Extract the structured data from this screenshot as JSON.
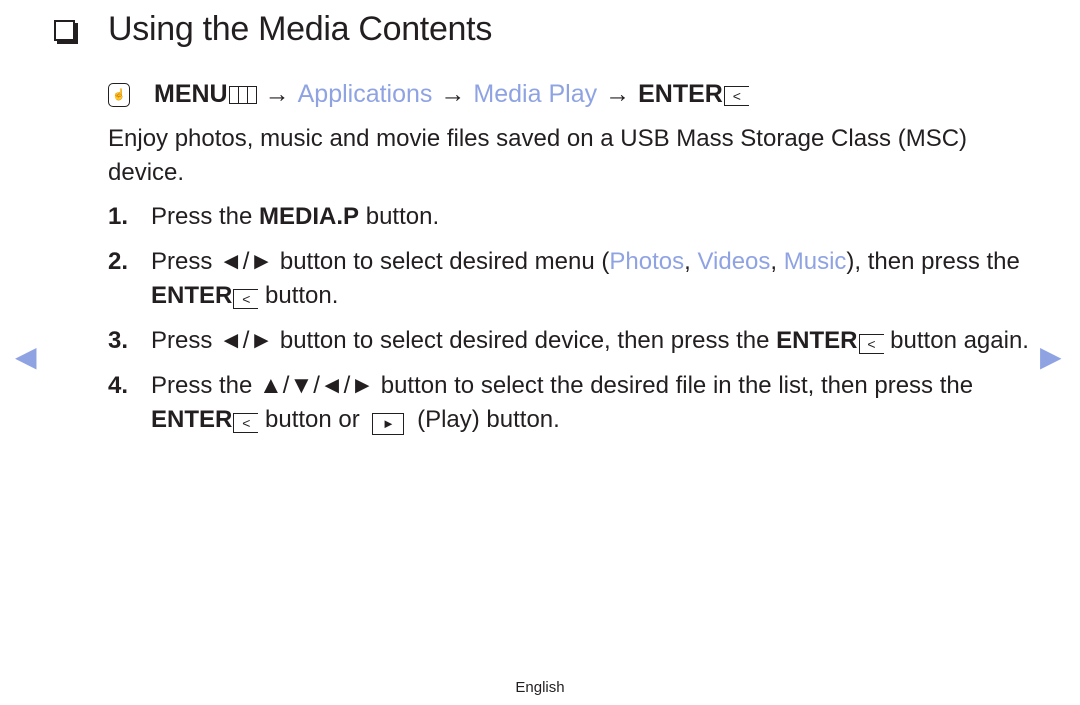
{
  "title": "Using the Media Contents",
  "menu_path": {
    "icon": "om-hand-icon",
    "menu_label": "MENU",
    "arrow": "→",
    "applications": "Applications",
    "media_play": "Media Play",
    "enter_label": "ENTER",
    "enter_symbol": "⏎"
  },
  "intro": "Enjoy photos, music and movie files saved on a USB Mass Storage Class (MSC) device.",
  "steps": [
    {
      "num": "1.",
      "pre": "Press the ",
      "bold": "MEDIA.P",
      "post": " button."
    },
    {
      "num": "2.",
      "pre": "Press ◄/► button to select desired menu (",
      "opt1": "Photos",
      "sep1": ", ",
      "opt2": "Videos",
      "sep2": ", ",
      "opt3": "Music",
      "mid": "), then press the ",
      "bold": "ENTER",
      "post": " button."
    },
    {
      "num": "3.",
      "pre": "Press ◄/► button to select desired device, then press the ",
      "bold": "ENTER",
      "post": " button again."
    },
    {
      "num": "4.",
      "pre": "Press the ▲/▼/◄/► button to select the desired file in the list, then press the ",
      "bold": "ENTER",
      "mid": " button or ",
      "play": "►",
      "post": " (Play) button."
    }
  ],
  "nav": {
    "prev": "◀",
    "next": "▶"
  },
  "footer": "English",
  "colors": {
    "accent": "#8fa3e3",
    "text": "#231f20"
  }
}
